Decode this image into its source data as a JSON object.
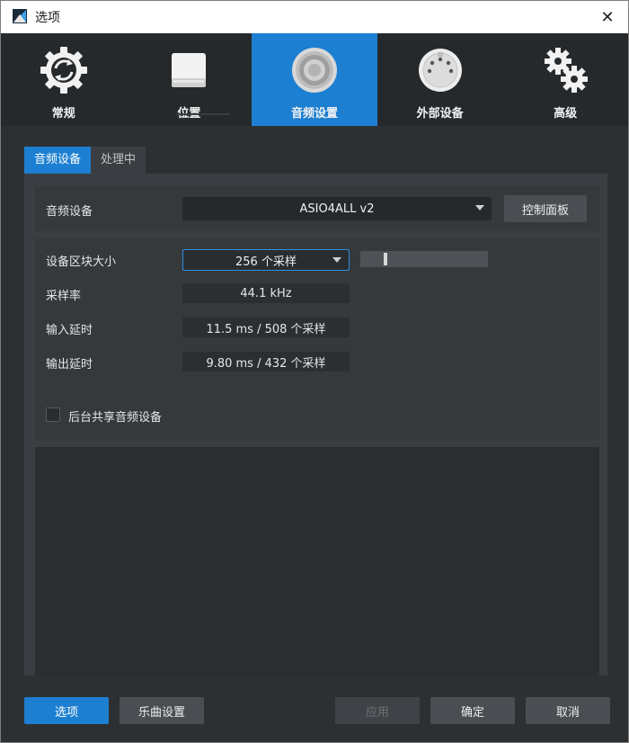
{
  "window": {
    "title": "选项",
    "close_glyph": "✕"
  },
  "topnav": {
    "items": [
      {
        "label": "常规",
        "icon": "sync-gear-icon",
        "active": false
      },
      {
        "label": "位置",
        "icon": "drive-icon",
        "active": false
      },
      {
        "label": "音频设置",
        "icon": "speaker-icon",
        "active": true
      },
      {
        "label": "外部设备",
        "icon": "midi-port-icon",
        "active": false
      },
      {
        "label": "高级",
        "icon": "gears-icon",
        "active": false
      }
    ]
  },
  "subtabs": [
    {
      "label": "音频设备",
      "active": true
    },
    {
      "label": "处理中",
      "active": false
    }
  ],
  "audio_device": {
    "label": "音频设备",
    "value": "ASIO4ALL v2",
    "control_panel_label": "控制面板"
  },
  "settings": {
    "block_size_label": "设备区块大小",
    "block_size_value": "256 个采样",
    "block_size_fraction": 0.1,
    "sample_rate_label": "采样率",
    "sample_rate_value": "44.1 kHz",
    "input_latency_label": "输入延时",
    "input_latency_value": "11.5 ms / 508 个采样",
    "output_latency_label": "输出延时",
    "output_latency_value": "9.80 ms / 432 个采样",
    "background_share_label": "后台共享音频设备",
    "background_share_checked": false
  },
  "bottom": {
    "options_label": "选项",
    "song_settings_label": "乐曲设置",
    "apply_label": "应用",
    "ok_label": "确定",
    "cancel_label": "取消"
  },
  "colors": {
    "accent": "#1d7fd1",
    "background": "#2d3033",
    "nav_background": "#26292c"
  }
}
